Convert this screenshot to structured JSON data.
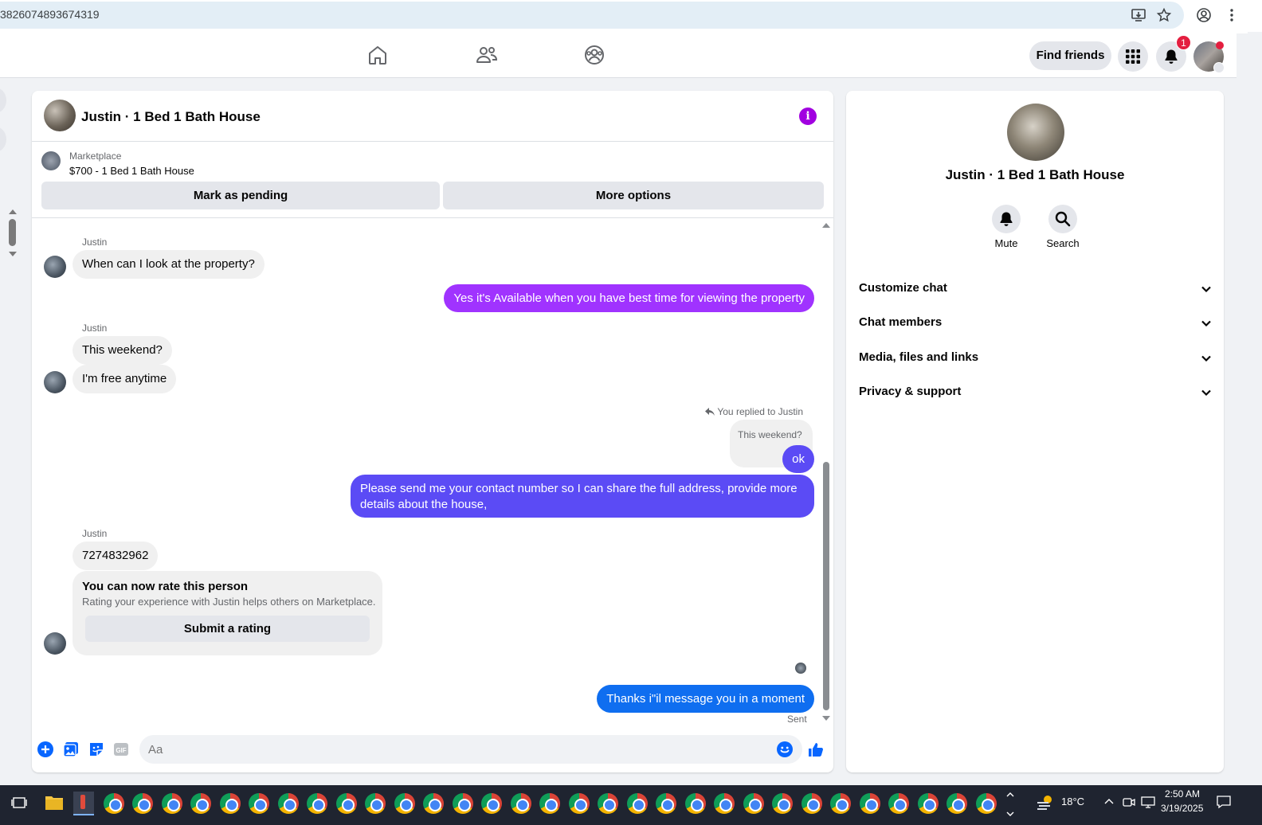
{
  "browser": {
    "url": "3826074893674319"
  },
  "header": {
    "find_friends": "Find friends",
    "notification_count": "1"
  },
  "chat": {
    "title": "Justin · 1 Bed 1 Bath House",
    "marketplace_label": "Marketplace",
    "listing": "$700 - 1 Bed 1 Bath House",
    "mark_pending": "Mark as pending",
    "more_options": "More options",
    "messages": {
      "sender1": "Justin",
      "m1": "When can I look at the property?",
      "m2": "Yes it's Available when you have best time for viewing the property",
      "sender2": "Justin",
      "m3": "This weekend?",
      "m4": "I'm free anytime",
      "reply_hint": "You replied to Justin",
      "quoted": "This weekend?",
      "m5": "ok",
      "m6": "Please send me your contact number so I can share the full address, provide more details about the house,",
      "sender3": "Justin",
      "m7": "7274832962",
      "rate_title": "You can now rate this person",
      "rate_sub": "Rating your experience with Justin helps others on Marketplace.",
      "rate_button": "Submit a rating",
      "m8": "Thanks i\"il message you in a moment",
      "status": "Sent"
    },
    "composer": {
      "placeholder": "Aa"
    }
  },
  "side": {
    "title": "Justin · 1 Bed 1 Bath House",
    "mute": "Mute",
    "search": "Search",
    "sections": [
      "Customize chat",
      "Chat members",
      "Media, files and links",
      "Privacy & support"
    ]
  },
  "taskbar": {
    "temperature": "18°C",
    "time": "2:50 AM",
    "date": "3/19/2025"
  },
  "colors": {
    "accent": "#0866ff",
    "bubble_purple": "#a033ff",
    "bubble_indigo": "#5b4bf5",
    "bubble_blue": "#0f6ef0"
  }
}
